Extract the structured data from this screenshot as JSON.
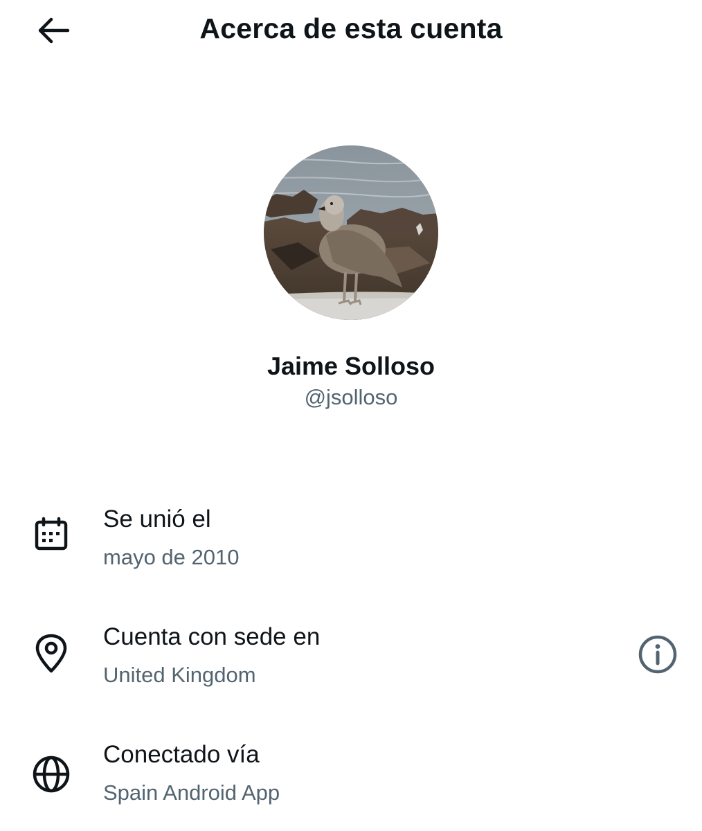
{
  "header": {
    "title": "Acerca de esta cuenta",
    "back_icon": "arrow-left-icon"
  },
  "profile": {
    "display_name": "Jaime Solloso",
    "handle": "@jsolloso",
    "avatar_icon": "seagull-photo"
  },
  "rows": [
    {
      "icon": "calendar-icon",
      "label": "Se unió el",
      "value": "mayo de 2010"
    },
    {
      "icon": "location-pin-icon",
      "label": "Cuenta con sede en",
      "value": "United Kingdom",
      "action_icon": "info-circle-icon"
    },
    {
      "icon": "globe-icon",
      "label": "Conectado vía",
      "value": "Spain Android App"
    }
  ],
  "colors": {
    "primary_text": "#0f1419",
    "secondary_text": "#536471",
    "background": "#ffffff"
  }
}
